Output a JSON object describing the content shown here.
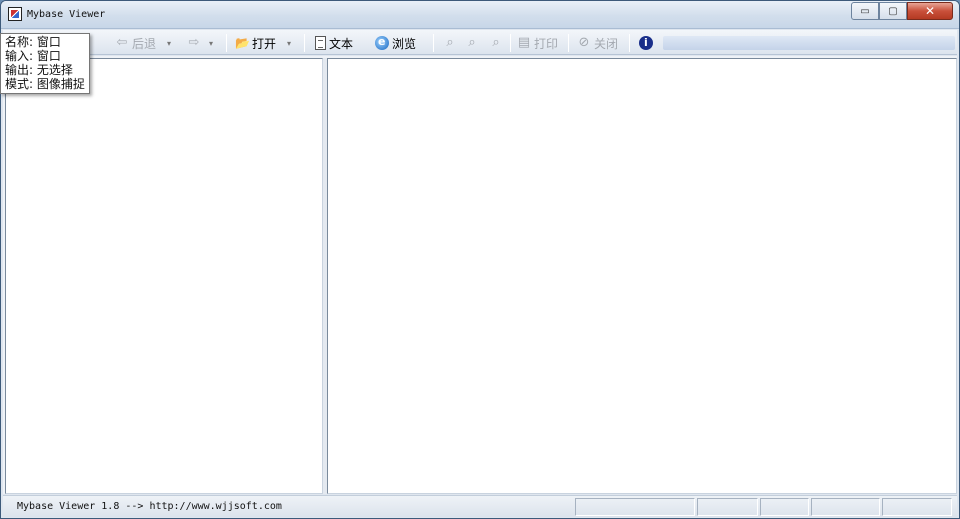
{
  "window": {
    "title": "Mybase Viewer"
  },
  "titlebar": {
    "minimize_glyph": "▭",
    "maximize_glyph": "▢",
    "close_glyph": "✕"
  },
  "toolbar": {
    "back_label": "后退",
    "open_label": "打开",
    "text_label": "文本",
    "browse_label": "浏览",
    "print_label": "打印",
    "close_label": "关闭",
    "dropdown_glyph": "▾"
  },
  "tooltip": {
    "lines": [
      "名称: 窗口",
      "输入: 窗口",
      "输出: 无选择",
      "模式: 图像捕捉"
    ]
  },
  "statusbar": {
    "text": "Mybase Viewer 1.8  --> http://www.wjjsoft.com"
  },
  "icons": {
    "app": "mybase-app-icon",
    "back": "back-arrow-icon",
    "forward": "forward-arrow-icon",
    "open": "open-folder-icon",
    "text": "document-icon",
    "browse": "internet-explorer-icon",
    "find_prev": "binoculars-left-icon",
    "find": "binoculars-icon",
    "find_next": "binoculars-right-icon",
    "print": "printer-icon",
    "close": "no-entry-icon",
    "info": "info-icon"
  },
  "colors": {
    "titlebar": "#d2deec",
    "close_button": "#c9503a",
    "pane_background": "#ffffff",
    "disabled_text": "#a4a9b0"
  }
}
